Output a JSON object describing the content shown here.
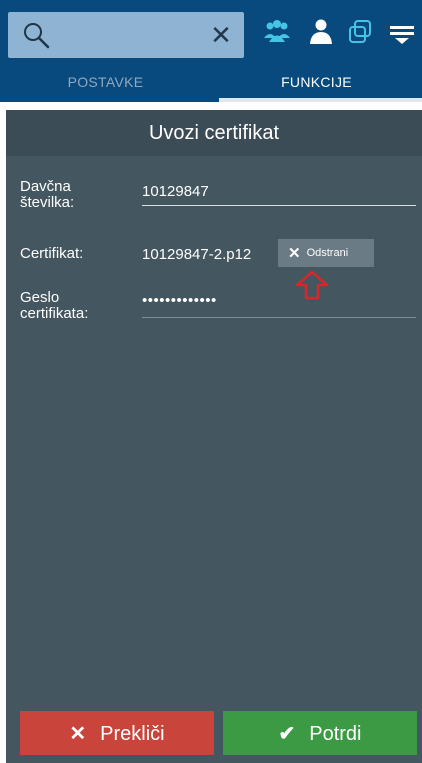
{
  "search": {
    "value": "",
    "placeholder": "",
    "icon": "search-icon",
    "clear_symbol": "✕"
  },
  "toolbar": {
    "icons": [
      "users-icon",
      "user-icon",
      "window-icon",
      "menu-icon"
    ]
  },
  "tabs": [
    {
      "label": "POSTAVKE",
      "active": false
    },
    {
      "label": "FUNKCIJE",
      "active": true
    }
  ],
  "dialog": {
    "title": "Uvozi certifikat",
    "tax_number": {
      "label_line1": "Davčna",
      "label_line2": "številka:",
      "value": "10129847"
    },
    "certificate": {
      "label": "Certifikat:",
      "file_name": "10129847-2.p12",
      "remove_label": "Odstrani",
      "remove_symbol": "✕"
    },
    "password": {
      "label_line1": "Geslo",
      "label_line2": "certifikata:",
      "masked_value": "•••••••••••••"
    }
  },
  "actions": {
    "cancel_label": "Prekliči",
    "cancel_symbol": "✕",
    "confirm_label": "Potrdi",
    "confirm_symbol": "✔"
  },
  "colors": {
    "app_bar": "#08497e",
    "panel_bg": "#44565f",
    "cancel": "#c9453b",
    "confirm": "#3c9a45",
    "highlight_arrow": "#d9262c"
  }
}
